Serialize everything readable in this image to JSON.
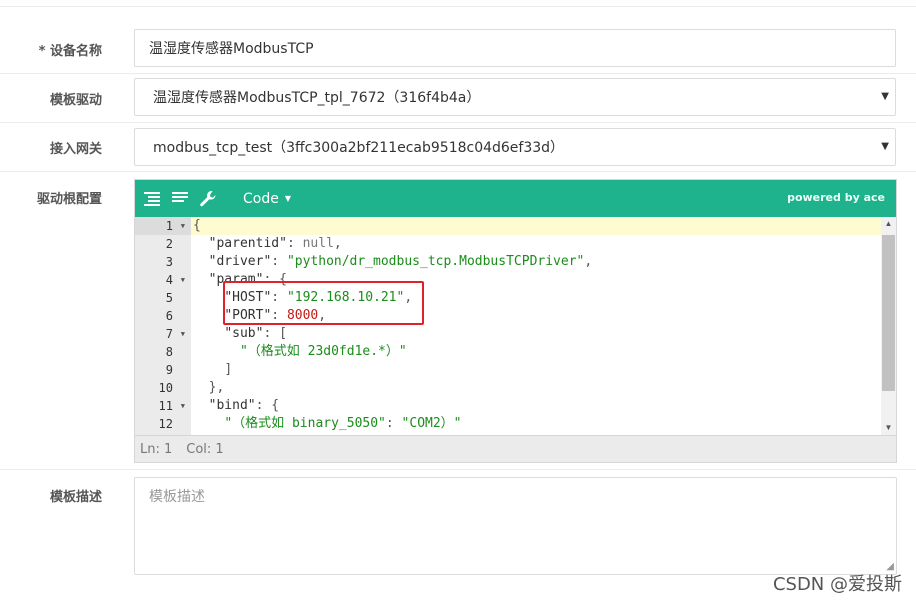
{
  "form": {
    "device_name": {
      "label": "设备名称",
      "required_mark": "*",
      "value": "温湿度传感器ModbusTCP"
    },
    "template_driver": {
      "label": "模板驱动",
      "value": "温湿度传感器ModbusTCP_tpl_7672（316f4b4a）"
    },
    "gateway": {
      "label": "接入网关",
      "value": "modbus_tcp_test（3ffc300a2bf211ecab9518c04d6ef33d）"
    },
    "driver_config": {
      "label": "驱动根配置"
    },
    "template_desc": {
      "label": "模板描述",
      "placeholder": "模板描述"
    }
  },
  "editor": {
    "mode_label": "Code",
    "powered_by": "powered by ace",
    "icons": [
      "format-icon",
      "compact-icon",
      "repair-wrench-icon"
    ],
    "line_numbers": [
      "1",
      "2",
      "3",
      "4",
      "5",
      "6",
      "7",
      "8",
      "9",
      "10",
      "11",
      "12"
    ],
    "fold_lines": [
      1,
      4,
      7,
      11
    ],
    "status": {
      "line": "Ln: 1",
      "col": "Col: 1"
    }
  },
  "watermark": "CSDN @爱投斯"
}
